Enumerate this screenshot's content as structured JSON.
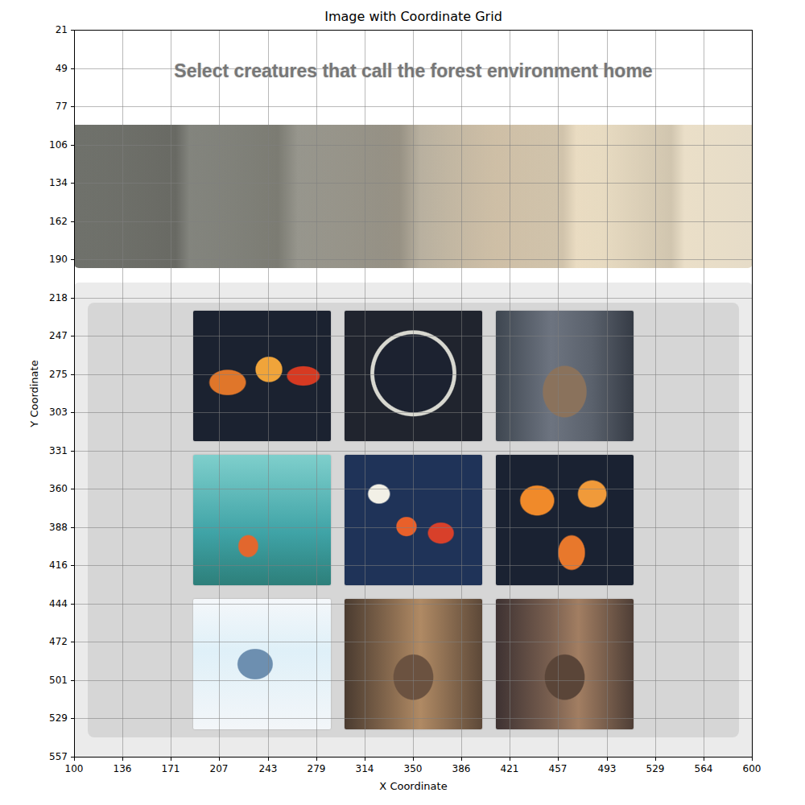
{
  "title": "Image with Coordinate Grid",
  "instruction": "Select creatures that call the forest environment home",
  "x_axis": {
    "label": "X Coordinate",
    "ticks": [
      "100",
      "136",
      "171",
      "207",
      "243",
      "279",
      "314",
      "350",
      "386",
      "421",
      "457",
      "493",
      "529",
      "564",
      "600"
    ]
  },
  "y_axis": {
    "label": "Y Coordinate",
    "ticks": [
      "21",
      "49",
      "77",
      "106",
      "134",
      "162",
      "190",
      "218",
      "247",
      "275",
      "303",
      "331",
      "360",
      "388",
      "416",
      "444",
      "472",
      "501",
      "529",
      "557"
    ]
  }
}
